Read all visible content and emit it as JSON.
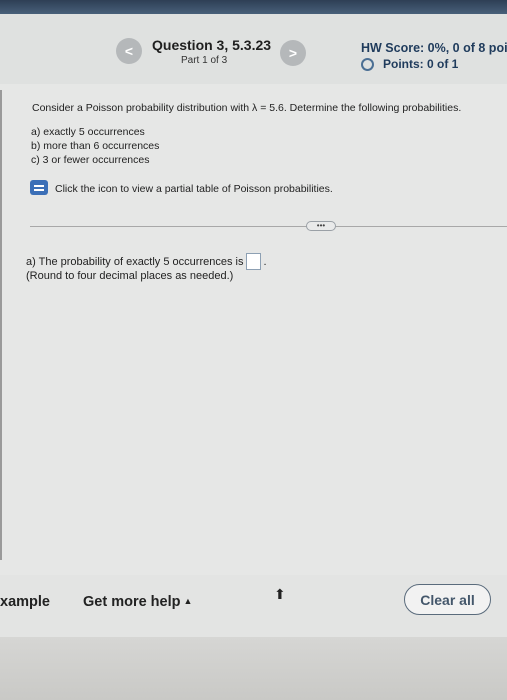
{
  "header": {
    "prev_glyph": "<",
    "next_glyph": ">",
    "question_title": "Question 3, 5.3.23",
    "part": "Part 1 of 3",
    "hw_score": "HW Score: 0%, 0 of 8 poin",
    "points": "Points: 0 of 1"
  },
  "problem": {
    "prompt": "Consider a Poisson probability distribution with λ = 5.6. Determine the following probabilities.",
    "items": [
      "a) exactly 5 occurrences",
      "b) more than 6 occurrences",
      "c) 3 or fewer occurrences"
    ],
    "table_link": "Click the icon to view a partial table of Poisson probabilities.",
    "expand_label": "•••"
  },
  "answer": {
    "line_prefix": "a) The probability of exactly 5 occurrences is",
    "line_suffix": ".",
    "value": "",
    "note": "(Round to four decimal places as needed.)"
  },
  "footer": {
    "example_label": "xample",
    "help_label": "Get more help",
    "help_caret": "▲",
    "clear_label": "Clear all"
  },
  "icons": {
    "prev": "chevron-left-icon",
    "next": "chevron-right-icon",
    "points": "circle-icon",
    "table": "table-icon",
    "cursor": "cursor-icon"
  },
  "colors": {
    "header_bg": "#dfe1e0",
    "score_text": "#1f3b5c",
    "table_icon": "#3b6fb7",
    "page_bg": "#e6e7e6"
  }
}
